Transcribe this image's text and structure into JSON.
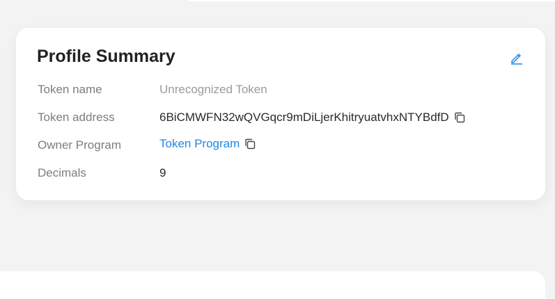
{
  "card": {
    "title": "Profile Summary",
    "edit_icon": "pencil-icon",
    "rows": [
      {
        "label": "Token name",
        "value": "Unrecognized Token"
      },
      {
        "label": "Token address",
        "value": "6BiCMWFN32wQVGqcr9mDiLjerKhitryuatvhxNTYBdfD",
        "icon": "copy-icon"
      },
      {
        "label": "Owner Program",
        "value": "Token Program",
        "icon": "copy-icon"
      },
      {
        "label": "Decimals",
        "value": "9"
      }
    ]
  },
  "colors": {
    "accent": "#1e88e5",
    "label": "#7d7d7d",
    "muted_value": "#9a9a9a",
    "background": "#f3f3f3"
  }
}
